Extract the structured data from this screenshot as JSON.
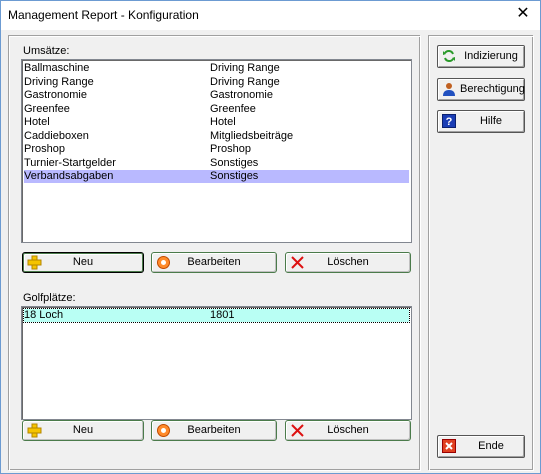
{
  "window": {
    "title": "Management Report - Konfiguration",
    "close_symbol": "✕"
  },
  "umsaetze": {
    "label": "Umsätze:",
    "rows": [
      {
        "name": "Ballmaschine",
        "category": "Driving Range"
      },
      {
        "name": "Driving Range",
        "category": "Driving Range"
      },
      {
        "name": "Gastronomie",
        "category": "Gastronomie"
      },
      {
        "name": "Greenfee",
        "category": "Greenfee"
      },
      {
        "name": "Hotel",
        "category": "Hotel"
      },
      {
        "name": "Caddieboxen",
        "category": "Mitgliedsbeiträge"
      },
      {
        "name": "Proshop",
        "category": "Proshop"
      },
      {
        "name": "Turnier-Startgelder",
        "category": "Sonstiges"
      },
      {
        "name": "Verbandsabgaben",
        "category": "Sonstiges"
      }
    ],
    "selected_index": 8,
    "buttons": {
      "new": "Neu",
      "edit": "Bearbeiten",
      "delete": "Löschen"
    }
  },
  "golfplaetze": {
    "label": "Golfplätze:",
    "rows": [
      {
        "name": "18 Loch",
        "id": "1801"
      }
    ],
    "selected_index": 0,
    "buttons": {
      "new": "Neu",
      "edit": "Bearbeiten",
      "delete": "Löschen"
    }
  },
  "sidebar": {
    "indizierung": "Indizierung",
    "berechtigung": "Berechtigung",
    "hilfe": "Hilfe",
    "ende": "Ende"
  },
  "icons": {
    "new": "plus-icon",
    "edit": "edit-circle-icon",
    "delete": "red-x-icon",
    "indizierung": "refresh-icon",
    "berechtigung": "user-icon",
    "hilfe": "help-icon",
    "ende": "exit-icon"
  },
  "colors": {
    "selected_row": "#b9b9ff",
    "focused_row": "#b9fff4",
    "window_bg": "#f0f0f0"
  }
}
